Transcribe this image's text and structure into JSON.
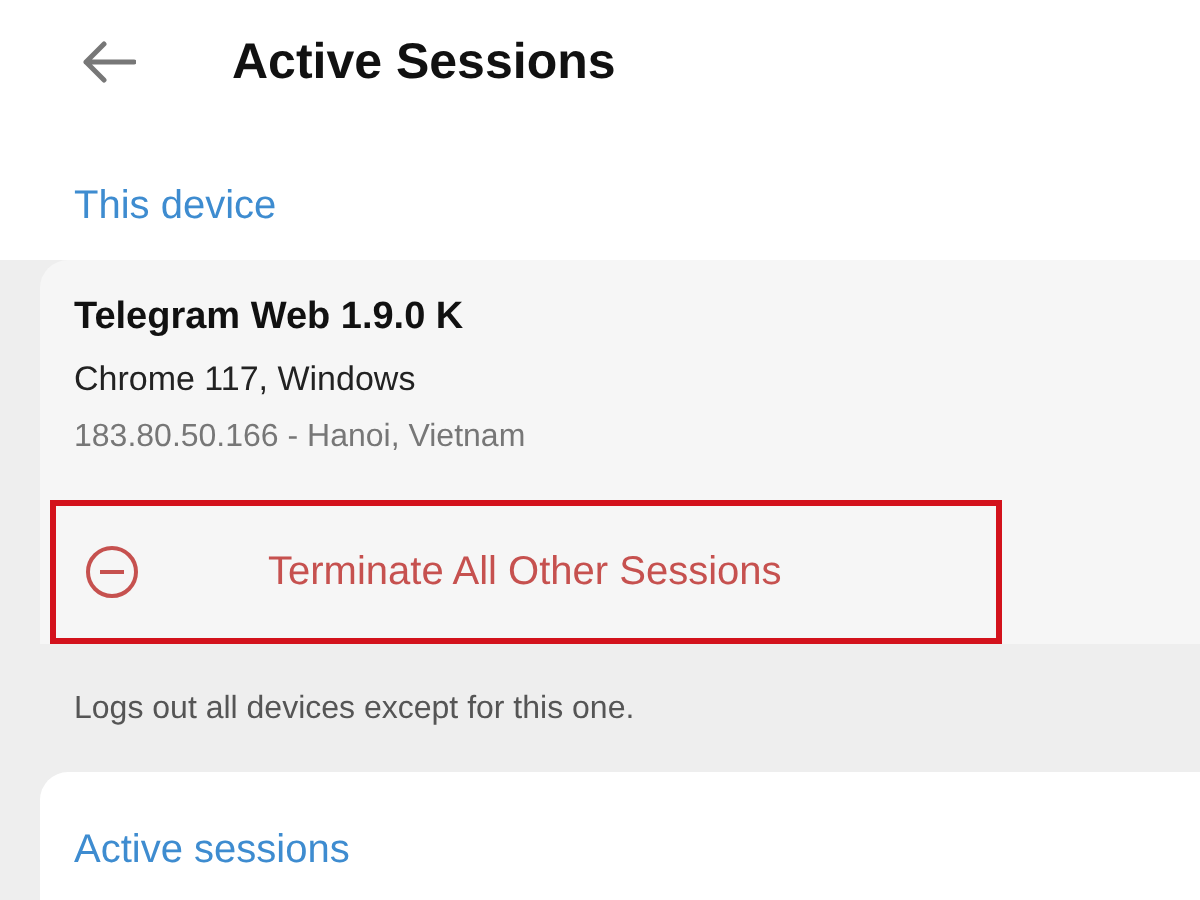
{
  "header": {
    "title": "Active Sessions"
  },
  "this_device": {
    "heading": "This device",
    "name": "Telegram Web 1.9.0 K",
    "browser": "Chrome 117, Windows",
    "location": "183.80.50.166 - Hanoi, Vietnam"
  },
  "terminate": {
    "label": "Terminate All Other Sessions",
    "highlighted": true,
    "caption": "Logs out all devices except for this one."
  },
  "active_sessions": {
    "heading": "Active sessions"
  }
}
